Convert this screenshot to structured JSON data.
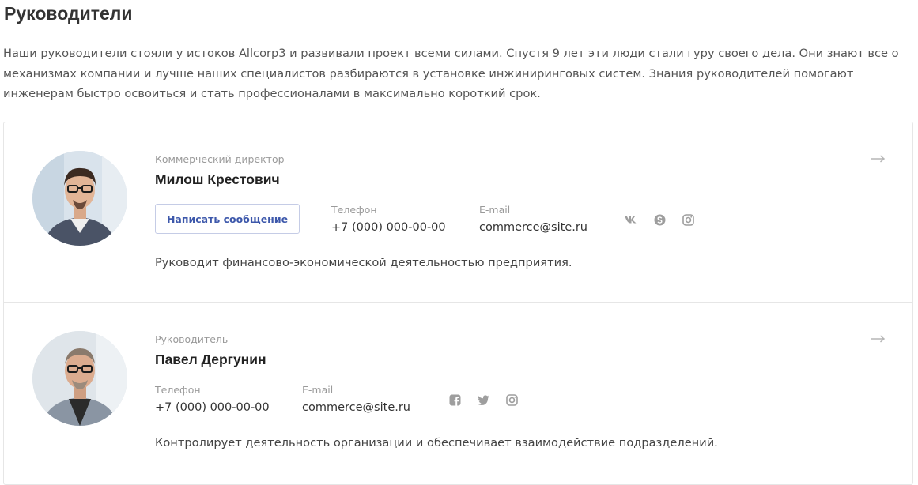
{
  "page": {
    "title": "Руководители",
    "intro": "Наши руководители стояли у истоков Allcorp3 и развивали проект всеми силами. Спустя 9 лет эти люди стали гуру своего дела. Они знают все о механизмах компании и лучше наших специалистов разбираются в установке инжиниринговых систем. Знания руководителей помогают инженерам быстро освоиться и стать профессионалами в максимально короткий срок."
  },
  "managers": [
    {
      "position": "Коммерческий директор",
      "name": "Милош Крестович",
      "message_button": "Написать сообщение",
      "phone_label": "Телефон",
      "phone": "+7 (000) 000-00-00",
      "email_label": "E-mail",
      "email": "commerce@site.ru",
      "socials": [
        "vk-icon",
        "skype-icon",
        "instagram-icon"
      ],
      "description": "Руководит финансово-экономической деятельностью предприятия."
    },
    {
      "position": "Руководитель",
      "name": "Павел Дергунин",
      "phone_label": "Телефон",
      "phone": "+7 (000) 000-00-00",
      "email_label": "E-mail",
      "email": "commerce@site.ru",
      "socials": [
        "facebook-icon",
        "twitter-icon",
        "instagram-icon"
      ],
      "description": "Контролирует деятельность организации и обеспечивает взаимодействие подразделений."
    }
  ],
  "colors": {
    "accent": "#3d58ab",
    "muted": "#9a9a9a",
    "border": "#e6e6e6",
    "icon": "#9e9e9e"
  }
}
